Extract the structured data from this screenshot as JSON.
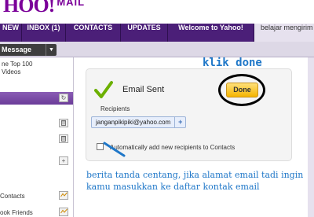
{
  "header": {
    "logo": "HOO!",
    "logo_product": "MAIL"
  },
  "tabs": [
    {
      "label": "NEW"
    },
    {
      "label": "INBOX (1)"
    },
    {
      "label": "CONTACTS"
    },
    {
      "label": "UPDATES"
    },
    {
      "label": "Welcome to Yahoo!"
    },
    {
      "label": "belajar mengirim"
    }
  ],
  "toolbar": {
    "new_message": "Message",
    "caret": "▼"
  },
  "sidebar": {
    "news_line1": "ne Top 100",
    "news_line2": "Videos",
    "refresh_icon": "↻",
    "trash_icon": "🗑",
    "add_icon": "+",
    "items": [
      {
        "label": "Contacts"
      },
      {
        "label": "ook Friends"
      }
    ]
  },
  "dialog": {
    "title": "Email Sent",
    "done_label": "Done",
    "recipients_label": "Recipients",
    "recipient": "janganpikipiki@yahoo.com",
    "add_recipient": "+",
    "auto_add_label": "Automatically add new recipients to Contacts"
  },
  "annotations": {
    "done_note": "klik done",
    "checkbox_note": "berita tanda centang, jika alamat email tadi ingin kamu masukkan ke daftar kontak email"
  },
  "colors": {
    "brand": "#7b0099",
    "nav": "#4b1f78",
    "done_button": "#f4b400",
    "annotation": "#1f77c8",
    "check": "#6cb000"
  }
}
